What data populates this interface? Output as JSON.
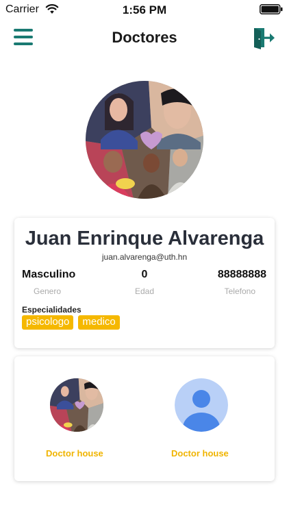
{
  "status_bar": {
    "carrier": "Carrier",
    "time": "1:56 PM"
  },
  "header": {
    "title": "Doctores",
    "menu_icon": "hamburger-menu-icon",
    "logout_icon": "logout-door-icon"
  },
  "profile": {
    "name": "Juan Enrinque Alvarenga",
    "email": "juan.alvarenga@uth.hn",
    "stats": [
      {
        "value": "Masculino",
        "label": "Genero"
      },
      {
        "value": "0",
        "label": "Edad"
      },
      {
        "value": "88888888",
        "label": "Telefono"
      }
    ],
    "specialties_title": "Especialidades",
    "specialties": [
      "psicologo",
      "medico"
    ]
  },
  "houses": [
    {
      "label": "Doctor house",
      "avatar": "photo-collage"
    },
    {
      "label": "Doctor house",
      "avatar": "generic-user-icon"
    }
  ],
  "colors": {
    "accent_teal": "#1a7a72",
    "tag_yellow": "#f5b800",
    "house_label": "#f0b400",
    "generic_avatar_bg": "#b9d0f7",
    "generic_avatar_fg": "#4a86e8"
  }
}
